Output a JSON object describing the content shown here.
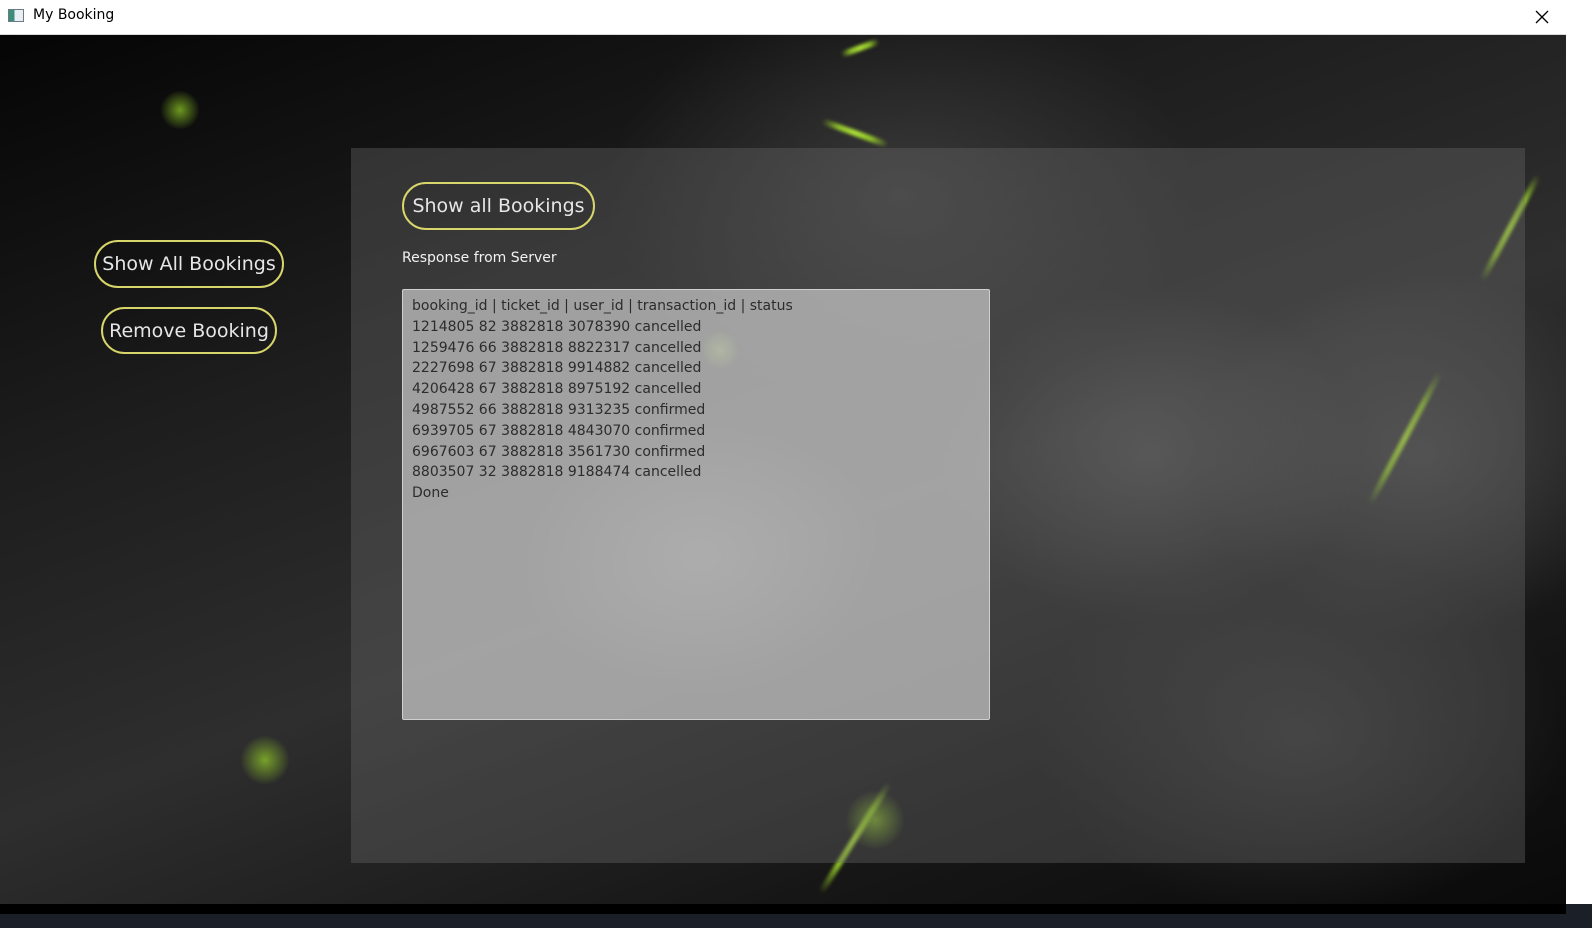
{
  "window": {
    "title": "My Booking",
    "close_icon": "close-icon"
  },
  "sidebar": {
    "buttons": [
      {
        "label": "Show All Bookings"
      },
      {
        "label": "Remove Booking"
      }
    ]
  },
  "panel": {
    "show_all_button": "Show all Bookings",
    "response_label": "Response from Server",
    "response_lines": [
      "booking_id | ticket_id | user_id | transaction_id | status",
      "1214805 82 3882818 3078390 cancelled",
      "1259476 66 3882818 8822317 cancelled",
      "2227698 67 3882818 9914882 cancelled",
      "4206428 67 3882818 8975192 cancelled",
      "4987552 66 3882818 9313235 confirmed",
      "6939705 67 3882818 4843070 confirmed",
      "6967603 67 3882818 3561730 confirmed",
      "8803507 32 3882818 9188474 cancelled",
      "Done"
    ]
  },
  "colors": {
    "button_border": "#d8d56a",
    "accent_green": "#9ed82a"
  }
}
